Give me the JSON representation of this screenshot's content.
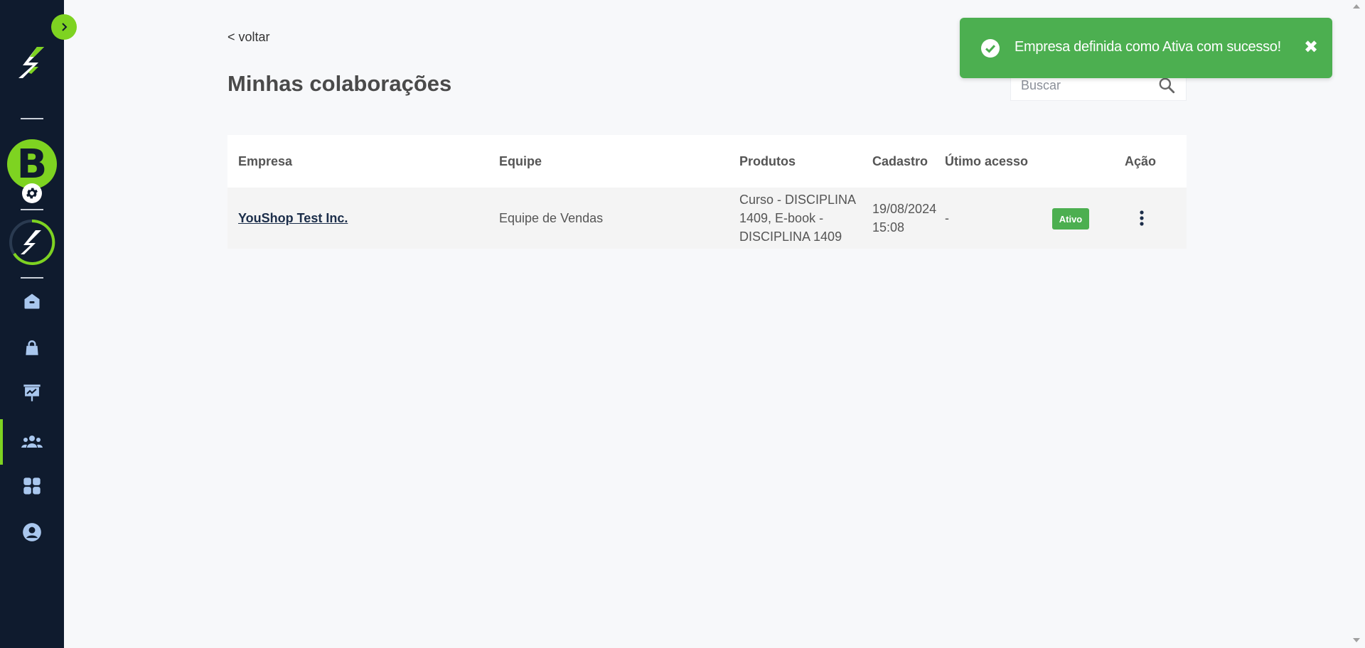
{
  "sidebar": {
    "avatar_letter": "B",
    "items": [
      {
        "name": "home",
        "icon": "home-icon"
      },
      {
        "name": "products",
        "icon": "bag-icon"
      },
      {
        "name": "reports",
        "icon": "presentation-chart-icon"
      },
      {
        "name": "collaborators",
        "icon": "users-icon",
        "active": true
      },
      {
        "name": "apps",
        "icon": "grid-icon"
      },
      {
        "name": "account",
        "icon": "user-circle-icon"
      }
    ],
    "accent_color": "#7ed321",
    "bg_color": "#0f1b2e"
  },
  "header": {
    "back_label": "< voltar",
    "title": "Minhas colaborações"
  },
  "search": {
    "placeholder": "Buscar",
    "value": ""
  },
  "table": {
    "columns": [
      "Empresa",
      "Equipe",
      "Produtos",
      "Cadastro",
      "Útimo acesso",
      "Ação"
    ],
    "rows": [
      {
        "empresa": "YouShop Test Inc.",
        "equipe": "Equipe de Vendas",
        "produtos": [
          "Curso - DISCIPLINA",
          "1409, E-book -",
          "DISCIPLINA 1409"
        ],
        "cadastro": [
          "19/08/2024",
          "15:08"
        ],
        "ultimo_acesso": "-",
        "status": "Ativo"
      }
    ]
  },
  "toast": {
    "message": "Empresa definida como Ativa com sucesso!",
    "close_symbol": "✖",
    "color": "#4caf50"
  }
}
